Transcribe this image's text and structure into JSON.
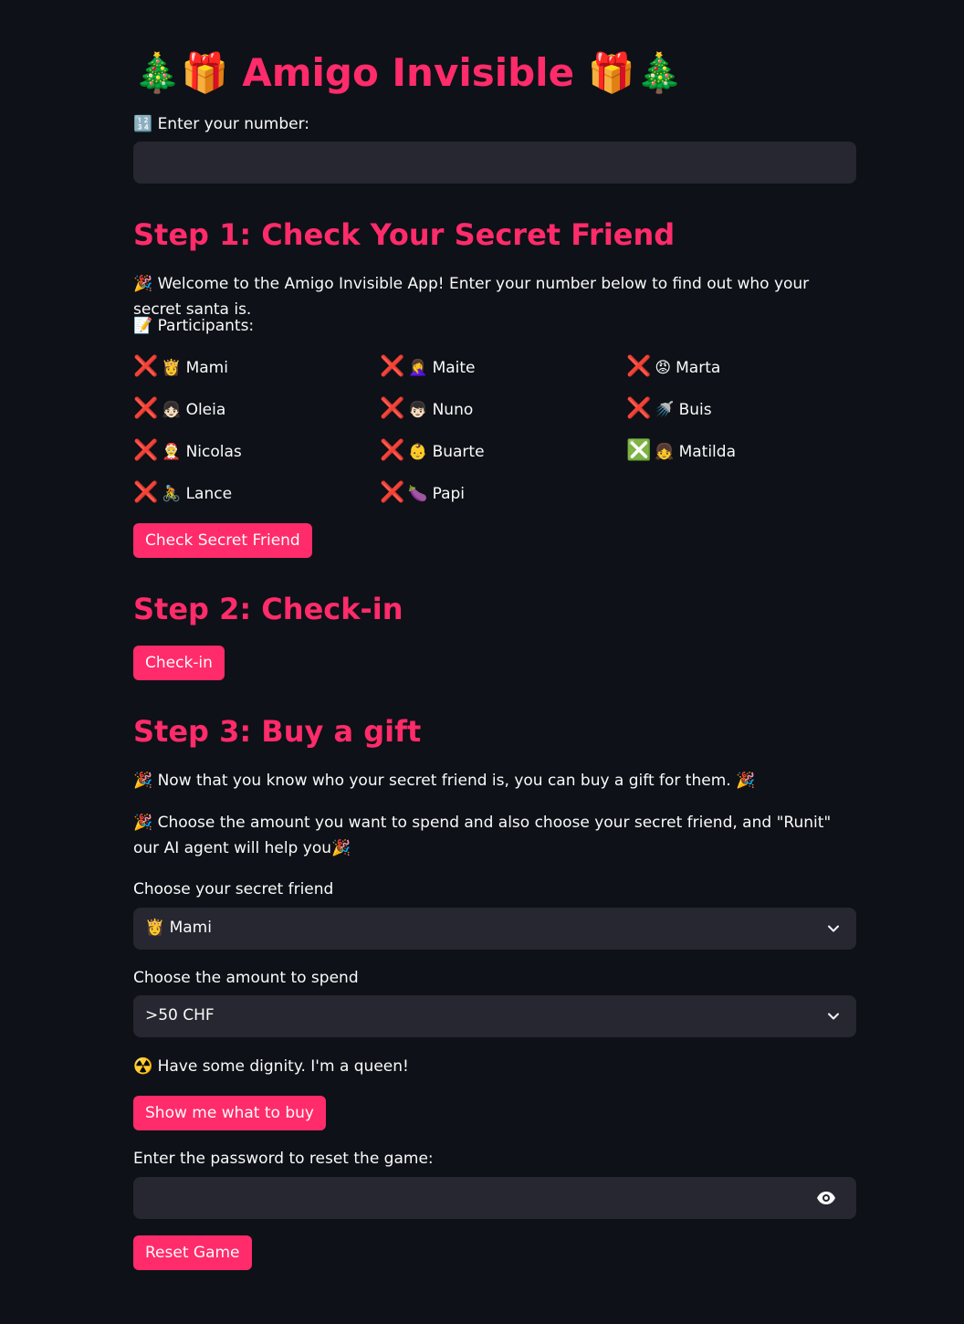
{
  "title": "🎄🎁 Amigo Invisible 🎁🎄",
  "number_input": {
    "label": "🔢 Enter your number:",
    "value": "",
    "placeholder": ""
  },
  "step1": {
    "heading": "Step 1: Check Your Secret Friend",
    "welcome": "🎉 Welcome to the Amigo Invisible App! Enter your number below to find out who your secret santa is.",
    "participants_label": "📝 Participants:",
    "participants": [
      {
        "status": "❌",
        "emoji": "👸",
        "name": "Mami"
      },
      {
        "status": "❌",
        "emoji": "🤦‍♀️",
        "name": "Maite"
      },
      {
        "status": "❌",
        "emoji": "😡",
        "name": "Marta"
      },
      {
        "status": "❌",
        "emoji": "👧🏻",
        "name": "Oleia"
      },
      {
        "status": "❌",
        "emoji": "👦🏻",
        "name": "Nuno"
      },
      {
        "status": "❌",
        "emoji": "🚿",
        "name": "Buis"
      },
      {
        "status": "❌",
        "emoji": "🤶",
        "name": "Nicolas"
      },
      {
        "status": "❌",
        "emoji": "👶",
        "name": "Buarte"
      },
      {
        "status": "❎",
        "emoji": "👧",
        "name": "Matilda"
      },
      {
        "status": "❌",
        "emoji": "🚴",
        "name": "Lance"
      },
      {
        "status": "❌",
        "emoji": "🍆",
        "name": "Papi"
      }
    ],
    "button": "Check Secret Friend"
  },
  "step2": {
    "heading": "Step 2: Check-in",
    "button": "Check-in"
  },
  "step3": {
    "heading": "Step 3: Buy a gift",
    "line1": "🎉 Now that you know who your secret friend is, you can buy a gift for them. 🎉",
    "line2": "🎉 Choose the amount you want to spend and also choose your secret friend, and \"Runit\" our AI agent will help you🎉",
    "friend_label": "Choose your secret friend",
    "friend_value": "👸 Mami",
    "amount_label": "Choose the amount to spend",
    "amount_value": ">50 CHF",
    "message": "☢️ Have some dignity. I'm a queen!",
    "show_button": "Show me what to buy",
    "password_label": "Enter the password to reset the game:",
    "password_value": "",
    "reset_button": "Reset Game"
  },
  "colors": {
    "background": "#0e1117",
    "accent": "#ff2b6a",
    "input_bg": "#262730",
    "text": "#fafafa"
  },
  "icons": {
    "select_chevron": "chevron-down-icon",
    "password_toggle": "eye-icon"
  }
}
